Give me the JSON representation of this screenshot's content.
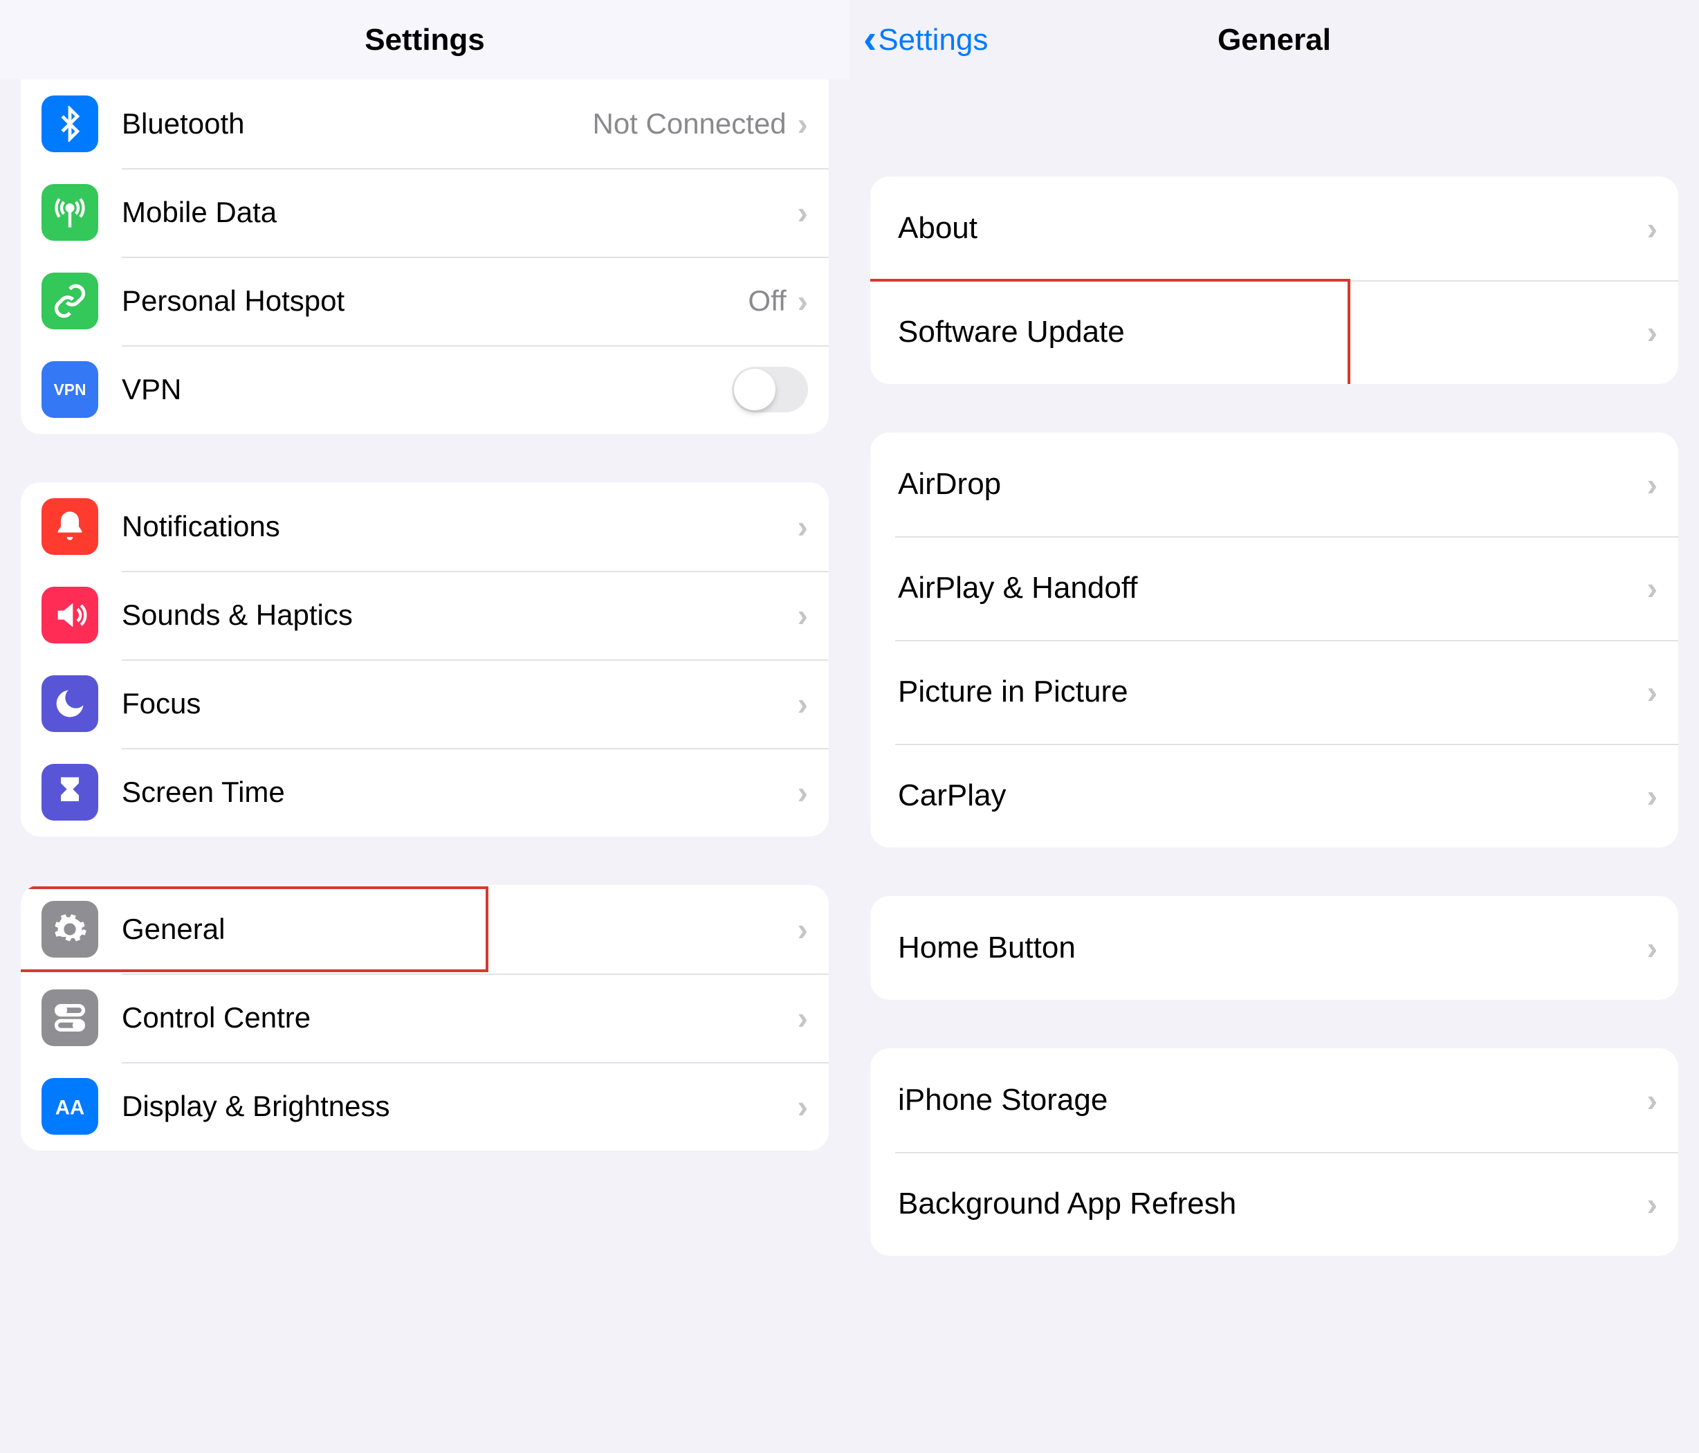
{
  "left": {
    "title": "Settings",
    "group1": [
      {
        "id": "bluetooth",
        "label": "Bluetooth",
        "value": "Not Connected",
        "icon_bg": "#007aff",
        "icon": "bluetooth"
      },
      {
        "id": "mobile-data",
        "label": "Mobile Data",
        "value": "",
        "icon_bg": "#34c759",
        "icon": "antenna"
      },
      {
        "id": "personal-hotspot",
        "label": "Personal Hotspot",
        "value": "Off",
        "icon_bg": "#34c759",
        "icon": "link"
      },
      {
        "id": "vpn",
        "label": "VPN",
        "value": "",
        "icon_bg": "#3478f6",
        "icon": "vpn",
        "control": "toggle",
        "toggle_on": false
      }
    ],
    "group2": [
      {
        "id": "notifications",
        "label": "Notifications",
        "icon_bg": "#ff3b30",
        "icon": "bell"
      },
      {
        "id": "sounds",
        "label": "Sounds & Haptics",
        "icon_bg": "#ff2d55",
        "icon": "speaker"
      },
      {
        "id": "focus",
        "label": "Focus",
        "icon_bg": "#5856d6",
        "icon": "moon"
      },
      {
        "id": "screen-time",
        "label": "Screen Time",
        "icon_bg": "#5856d6",
        "icon": "hourglass"
      }
    ],
    "group3": [
      {
        "id": "general",
        "label": "General",
        "icon_bg": "#8e8e93",
        "icon": "gear",
        "highlighted": true
      },
      {
        "id": "control-centre",
        "label": "Control Centre",
        "icon_bg": "#8e8e93",
        "icon": "toggles"
      },
      {
        "id": "display",
        "label": "Display & Brightness",
        "icon_bg": "#007aff",
        "icon": "aa"
      }
    ]
  },
  "right": {
    "back_label": "Settings",
    "title": "General",
    "group1": [
      {
        "id": "about",
        "label": "About"
      },
      {
        "id": "software-update",
        "label": "Software Update",
        "highlighted": true
      }
    ],
    "group2": [
      {
        "id": "airdrop",
        "label": "AirDrop"
      },
      {
        "id": "airplay",
        "label": "AirPlay & Handoff"
      },
      {
        "id": "pip",
        "label": "Picture in Picture"
      },
      {
        "id": "carplay",
        "label": "CarPlay"
      }
    ],
    "group3": [
      {
        "id": "home-button",
        "label": "Home Button"
      }
    ],
    "group4": [
      {
        "id": "iphone-storage",
        "label": "iPhone Storage"
      },
      {
        "id": "background-refresh",
        "label": "Background App Refresh"
      }
    ]
  }
}
